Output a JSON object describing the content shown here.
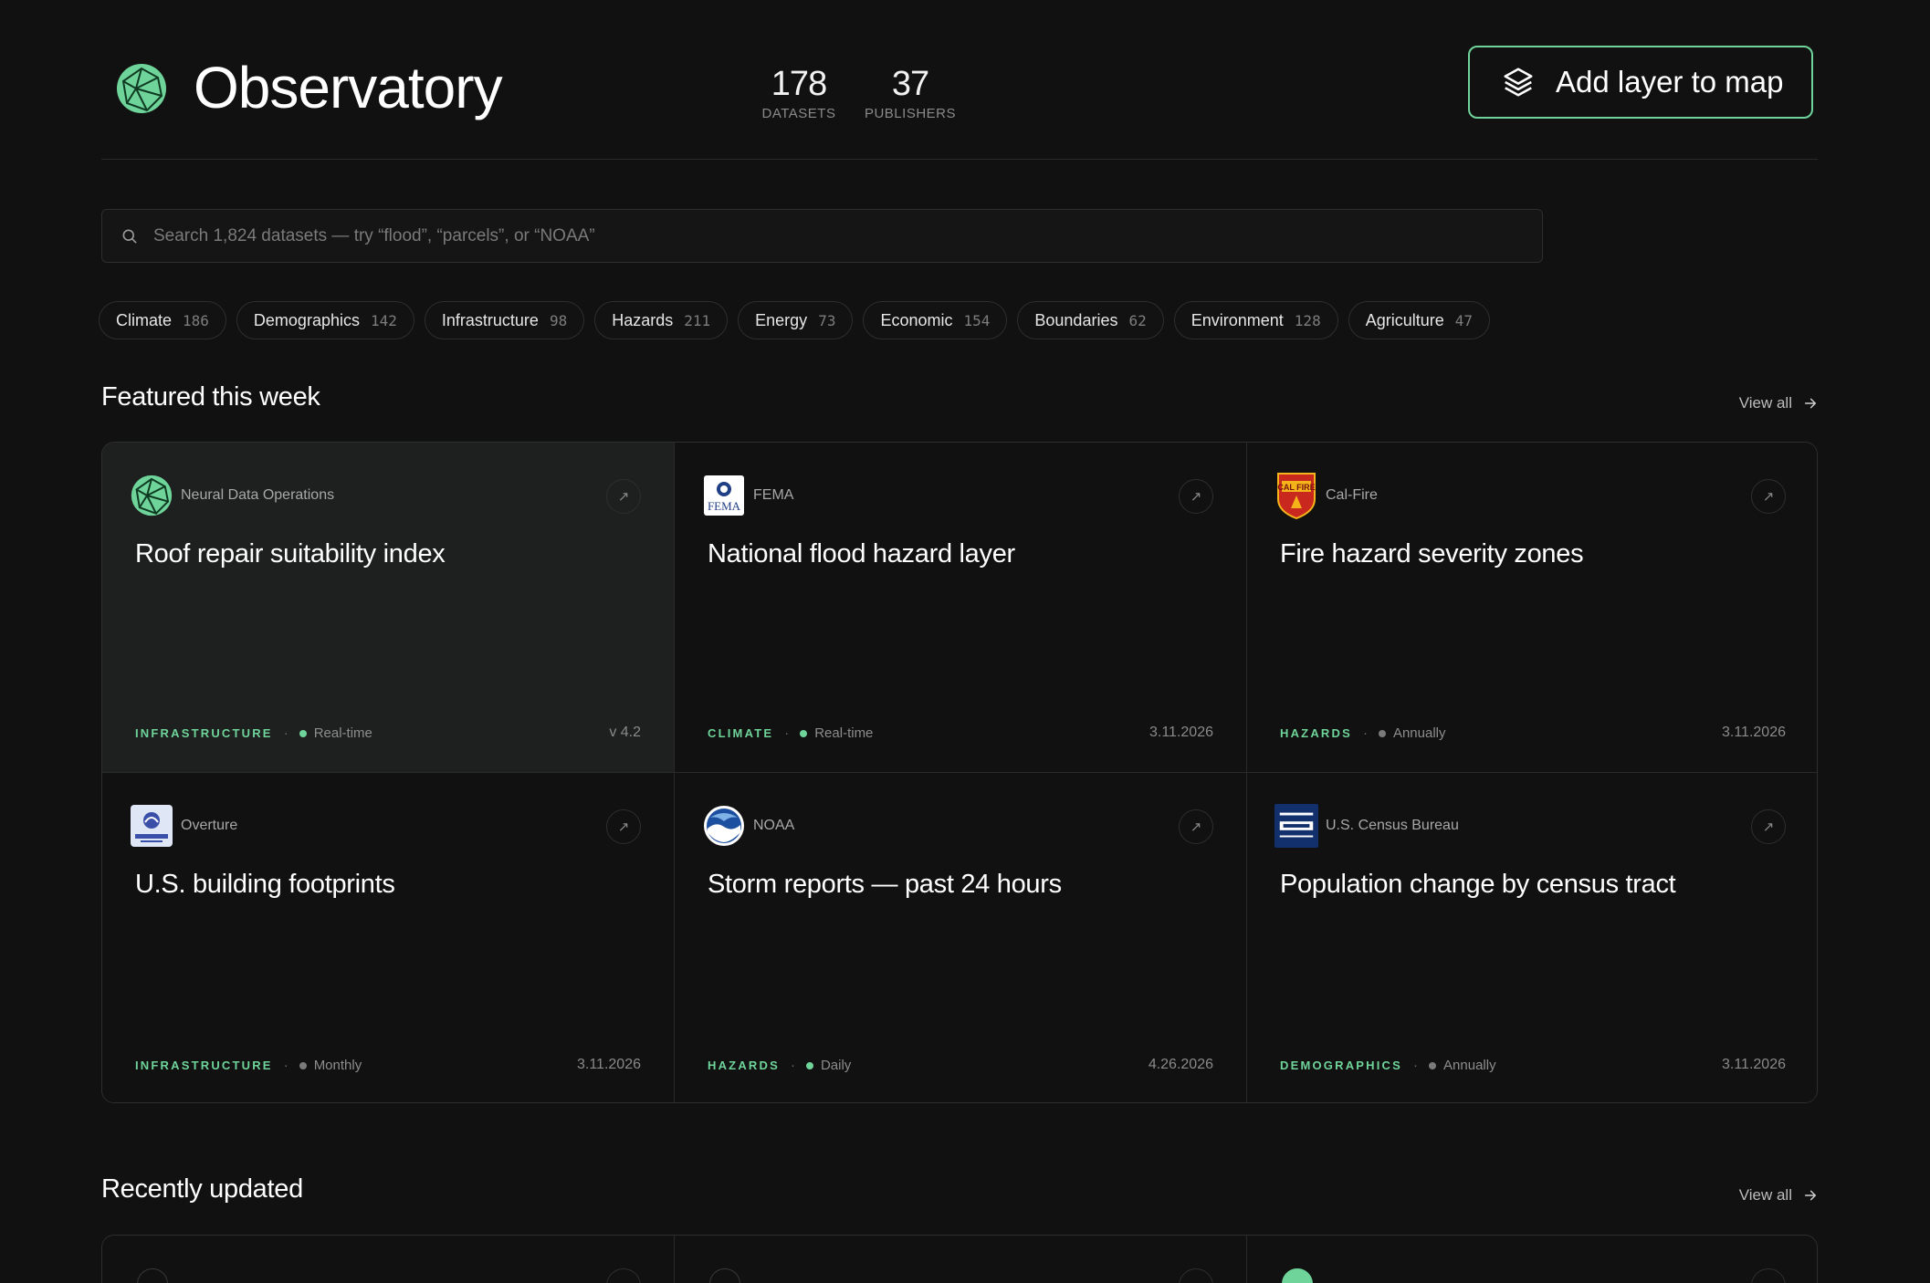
{
  "app": {
    "title": "Observatory"
  },
  "stats": [
    {
      "value": "178",
      "label": "DATASETS"
    },
    {
      "value": "37",
      "label": "PUBLISHERS"
    }
  ],
  "actions": {
    "add_layer": "Add layer to map"
  },
  "search": {
    "placeholder": "Search 1,824 datasets — try “flood”, “parcels”, or “NOAA”"
  },
  "categories": [
    {
      "label": "Climate",
      "count": "186"
    },
    {
      "label": "Demographics",
      "count": "142"
    },
    {
      "label": "Infrastructure",
      "count": "98"
    },
    {
      "label": "Hazards",
      "count": "211"
    },
    {
      "label": "Energy",
      "count": "73"
    },
    {
      "label": "Economic",
      "count": "154"
    },
    {
      "label": "Boundaries",
      "count": "62"
    },
    {
      "label": "Environment",
      "count": "128"
    },
    {
      "label": "Agriculture",
      "count": "47"
    }
  ],
  "featured": {
    "title": "Featured this week",
    "view_all": "View all",
    "cards": [
      {
        "publisher": "Neural Data Operations",
        "logo": "globe-icon",
        "title": "Roof repair suitability index",
        "category": "INFRASTRUCTURE",
        "frequency": "Real-time",
        "live": true,
        "right": "v 4.2"
      },
      {
        "publisher": "FEMA",
        "logo": "fema-logo",
        "title": "National flood hazard layer",
        "category": "CLIMATE",
        "frequency": "Real-time",
        "live": true,
        "right": "3.11.2026"
      },
      {
        "publisher": "Cal-Fire",
        "logo": "calfire-logo",
        "title": "Fire hazard severity zones",
        "category": "HAZARDS",
        "frequency": "Annually",
        "live": false,
        "right": "3.11.2026"
      },
      {
        "publisher": "Overture",
        "logo": "overture-logo",
        "title": "U.S. building footprints",
        "category": "INFRASTRUCTURE",
        "frequency": "Monthly",
        "live": false,
        "right": "3.11.2026"
      },
      {
        "publisher": "NOAA",
        "logo": "noaa-logo",
        "title": "Storm reports — past 24 hours",
        "category": "HAZARDS",
        "frequency": "Daily",
        "live": true,
        "right": "4.26.2026"
      },
      {
        "publisher": "U.S. Census Bureau",
        "logo": "census-logo",
        "title": "Population change by census tract",
        "category": "DEMOGRAPHICS",
        "frequency": "Annually",
        "live": false,
        "right": "3.11.2026"
      }
    ]
  },
  "recent": {
    "title": "Recently updated",
    "view_all": "View all"
  },
  "colors": {
    "accent": "#6fd49a",
    "background": "#111111",
    "card_highlight": "#1e1f1f"
  }
}
